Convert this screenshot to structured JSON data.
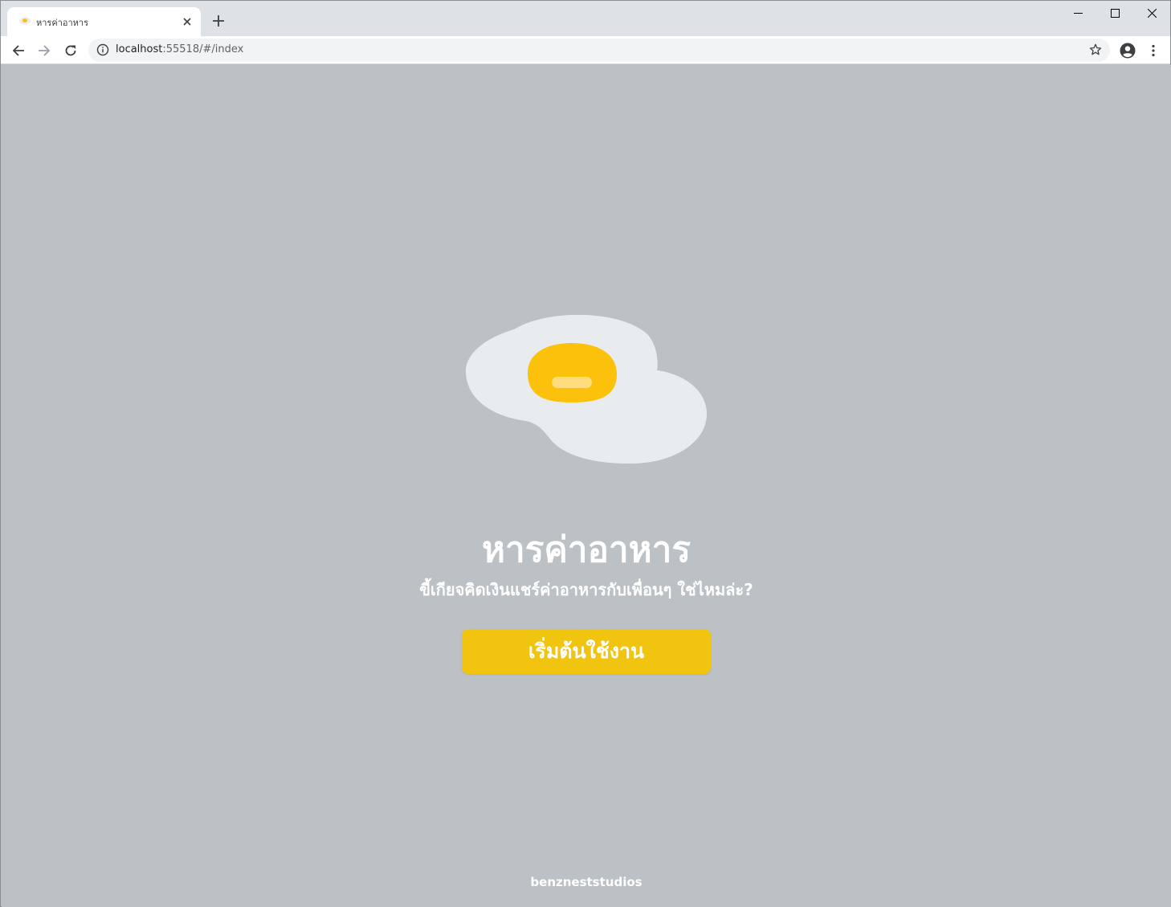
{
  "browser": {
    "tab_title": "หารค่าอาหาร",
    "tab_favicon": "egg-icon",
    "url_host": "localhost",
    "url_rest": ":55518/#/index"
  },
  "page": {
    "title": "หารค่าอาหาร",
    "subtitle": "ขี้เกียจคิดเงินแชร์ค่าอาหารกับเพื่อนๆ ใช่ไหมล่ะ?",
    "start_button": "เริ่มต้นใช้งาน",
    "footer": "benzneststudios"
  },
  "colors": {
    "background": "#bcc1c5",
    "egg_white": "#e9ecef",
    "yolk": "#fcc10b",
    "yolk_highlight": "#ffdc7d",
    "button": "#f1c40f",
    "text": "#ffffff"
  }
}
